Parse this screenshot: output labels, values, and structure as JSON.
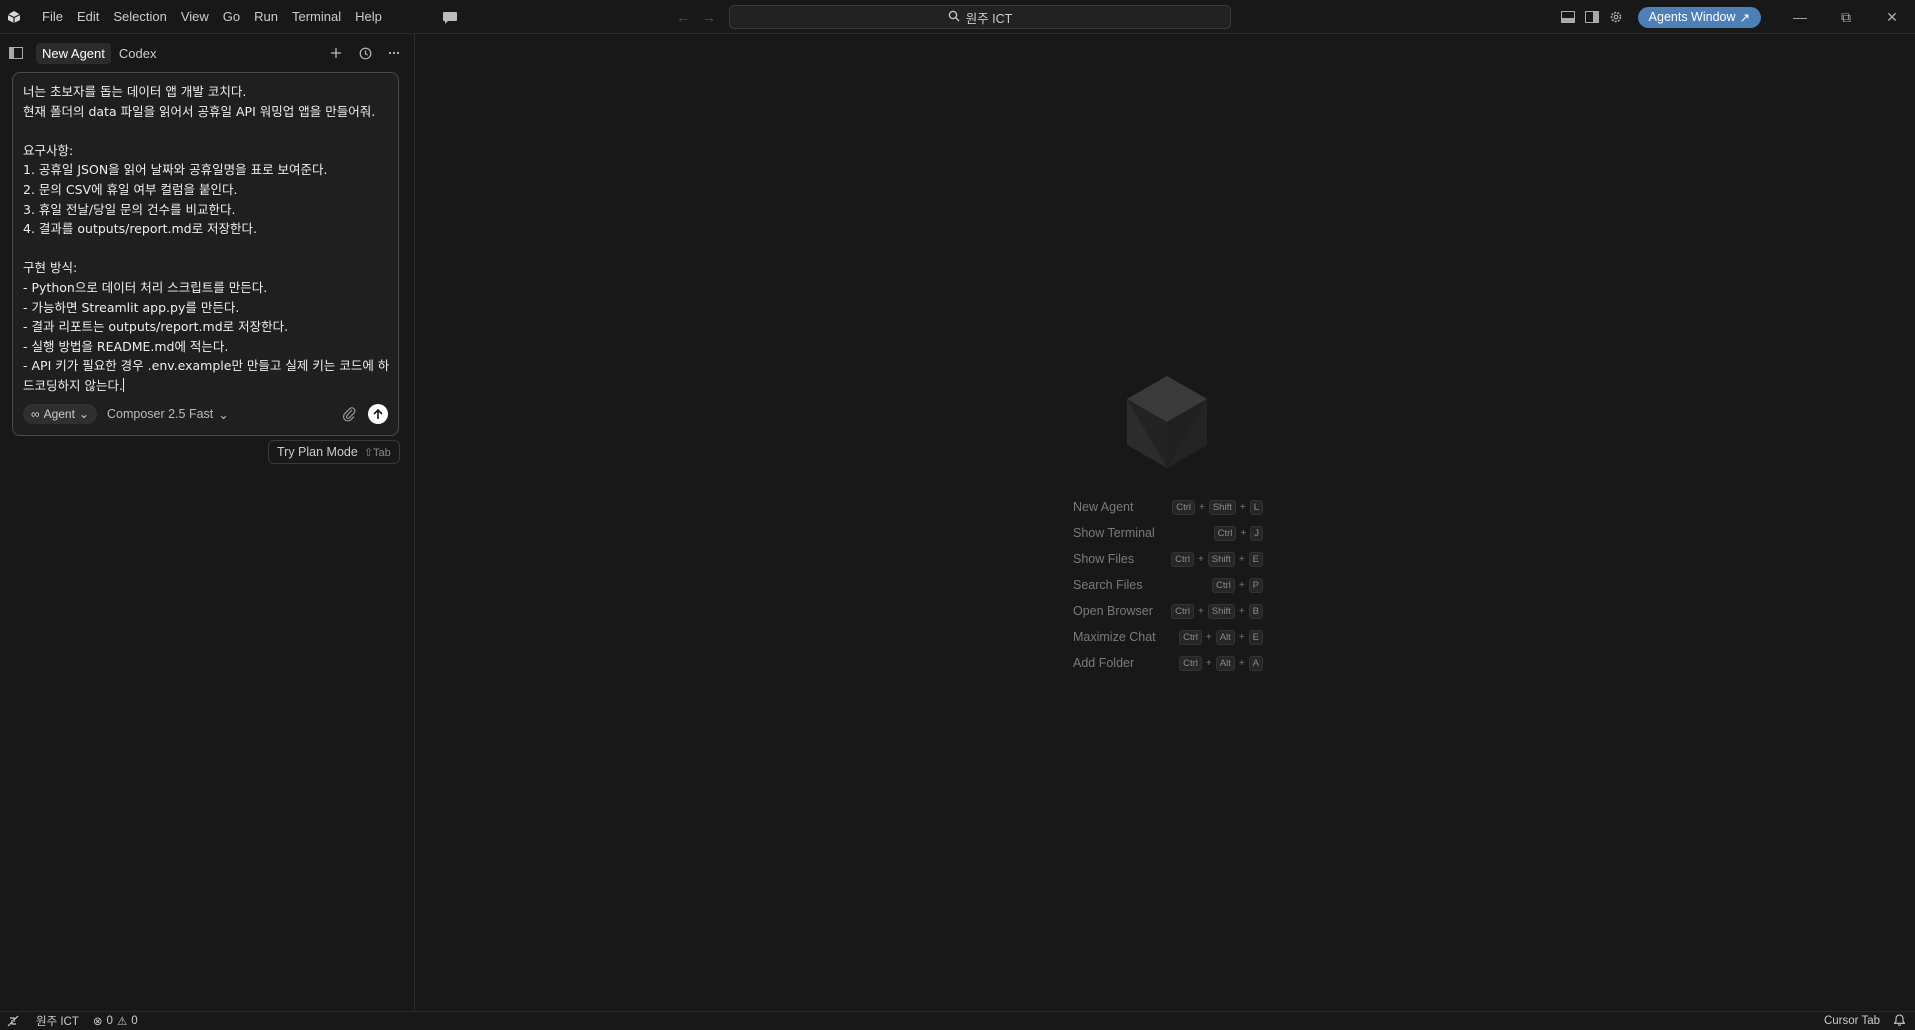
{
  "menu": [
    "File",
    "Edit",
    "Selection",
    "View",
    "Go",
    "Run",
    "Terminal",
    "Help"
  ],
  "search": {
    "label": "원주 ICT"
  },
  "title_right": {
    "agents_window": "Agents Window"
  },
  "panel": {
    "tabs": [
      "New Agent",
      "Codex"
    ]
  },
  "composer": {
    "prompt": "너는 초보자를 돕는 데이터 앱 개발 코치다.\n현재 폴더의 data 파일을 읽어서 공휴일 API 워밍업 앱을 만들어줘.\n\n요구사항:\n1. 공휴일 JSON을 읽어 날짜와 공휴일명을 표로 보여준다.\n2. 문의 CSV에 휴일 여부 컬럼을 붙인다.\n3. 휴일 전날/당일 문의 건수를 비교한다.\n4. 결과를 outputs/report.md로 저장한다.\n\n구현 방식:\n- Python으로 데이터 처리 스크립트를 만든다.\n- 가능하면 Streamlit app.py를 만든다.\n- 결과 리포트는 outputs/report.md로 저장한다.\n- 실행 방법을 README.md에 적는다.\n- API 키가 필요한 경우 .env.example만 만들고 실제 키는 코드에 하드코딩하지 않는다.",
    "mode": "Agent",
    "model": "Composer 2.5 Fast"
  },
  "plan_mode": {
    "label": "Try Plan Mode",
    "shortcut": "⇧Tab"
  },
  "shortcuts": [
    {
      "label": "New Agent",
      "keys": [
        "Ctrl",
        "Shift",
        "L"
      ]
    },
    {
      "label": "Show Terminal",
      "keys": [
        "Ctrl",
        "J"
      ]
    },
    {
      "label": "Show Files",
      "keys": [
        "Ctrl",
        "Shift",
        "E"
      ]
    },
    {
      "label": "Search Files",
      "keys": [
        "Ctrl",
        "P"
      ]
    },
    {
      "label": "Open Browser",
      "keys": [
        "Ctrl",
        "Shift",
        "B"
      ]
    },
    {
      "label": "Maximize Chat",
      "keys": [
        "Ctrl",
        "Alt",
        "E"
      ]
    },
    {
      "label": "Add Folder",
      "keys": [
        "Ctrl",
        "Alt",
        "A"
      ]
    }
  ],
  "statusbar": {
    "workspace": "원주 ICT",
    "errors": "0",
    "warnings": "0",
    "cursor_tab": "Cursor Tab"
  },
  "colors": {
    "accent": "#4d7fb8",
    "background": "#181818"
  }
}
